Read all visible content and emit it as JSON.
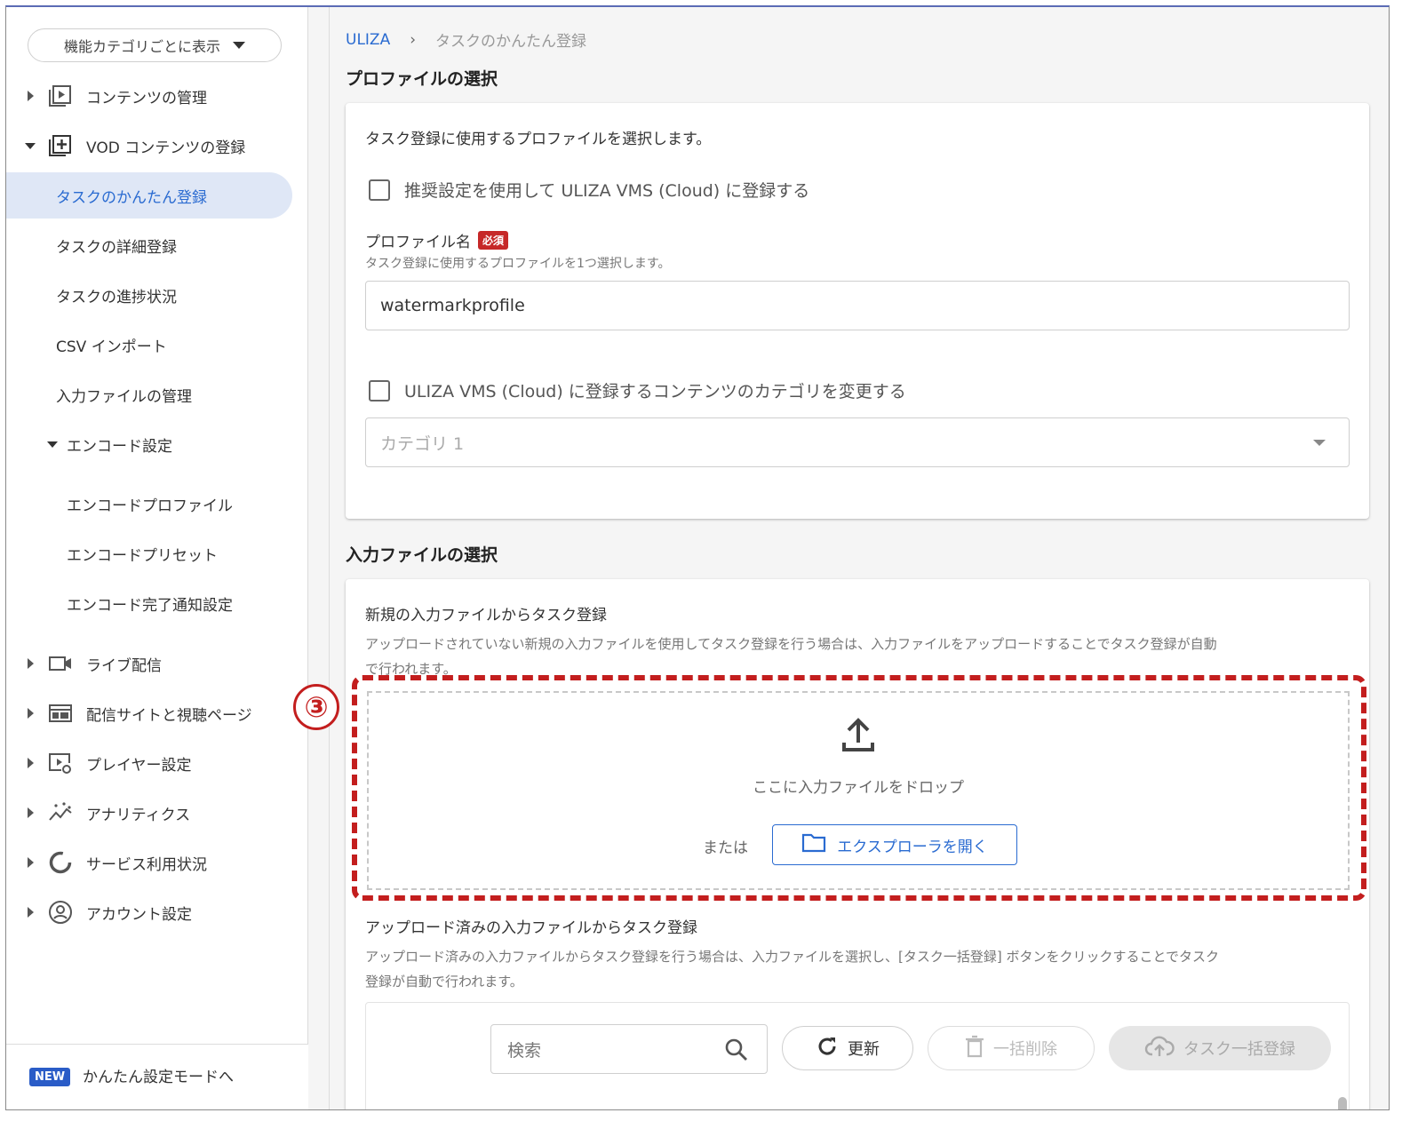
{
  "sidebar": {
    "category_select": "機能カテゴリごとに表示",
    "items": [
      {
        "label": "コンテンツの管理"
      },
      {
        "label": "VOD コンテンツの登録"
      },
      {
        "label": "タスクのかんたん登録"
      },
      {
        "label": "タスクの詳細登録"
      },
      {
        "label": "タスクの進捗状況"
      },
      {
        "label": "CSV インポート"
      },
      {
        "label": "入力ファイルの管理"
      },
      {
        "label": "エンコード設定"
      },
      {
        "label": "エンコードプロファイル"
      },
      {
        "label": "エンコードプリセット"
      },
      {
        "label": "エンコード完了通知設定"
      },
      {
        "label": "ライブ配信"
      },
      {
        "label": "配信サイトと視聴ページ"
      },
      {
        "label": "プレイヤー設定"
      },
      {
        "label": "アナリティクス"
      },
      {
        "label": "サービス利用状況"
      },
      {
        "label": "アカウント設定"
      }
    ],
    "footer": {
      "badge": "NEW",
      "label": "かんたん設定モードへ"
    }
  },
  "breadcrumb": {
    "root": "ULIZA",
    "sep": "›",
    "current": "タスクのかんたん登録"
  },
  "profile_section": {
    "title": "プロファイルの選択",
    "description": "タスク登録に使用するプロファイルを選択します。",
    "recommended_checkbox": "推奨設定を使用して ULIZA VMS (Cloud) に登録する",
    "profile_label": "プロファイル名",
    "required_badge": "必須",
    "profile_help": "タスク登録に使用するプロファイルを1つ選択します。",
    "profile_value": "watermarkprofile",
    "category_checkbox": "ULIZA VMS (Cloud) に登録するコンテンツのカテゴリを変更する",
    "category_value": "カテゴリ 1"
  },
  "input_section": {
    "title": "入力ファイルの選択",
    "new_title": "新規の入力ファイルからタスク登録",
    "new_desc_1": "アップロードされていない新規の入力ファイルを使用してタスク登録を行う場合は、入力ファイルをアップロードすることでタスク登録が自動",
    "new_desc_2": "で行われます。",
    "drop_text": "ここに入力ファイルをドロップ",
    "or_label": "または",
    "explorer_button": "エクスプローラを開く",
    "uploaded_title": "アップロード済みの入力ファイルからタスク登録",
    "uploaded_desc_1": "アップロード済みの入力ファイルからタスク登録を行う場合は、入力ファイルを選択し、[タスク一括登録] ボタンをクリックすることでタスク",
    "uploaded_desc_2": "登録が自動で行われます。",
    "search_placeholder": "検索",
    "refresh_button": "更新",
    "bulk_delete_button": "一括削除",
    "bulk_register_button": "タスク一括登録"
  },
  "annotation": {
    "number": "③"
  },
  "colors": {
    "accent": "#2a6bd1",
    "highlight": "#c31e1e",
    "required": "#c62828"
  }
}
